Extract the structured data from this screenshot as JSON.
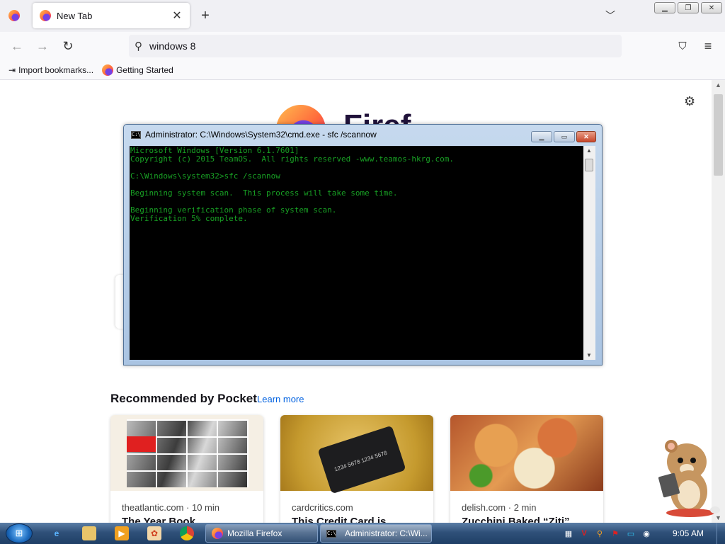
{
  "browser": {
    "tab": {
      "title": "New Tab"
    },
    "urlbar": {
      "value": "windows 8"
    },
    "bookmarks": [
      {
        "label": "Import bookmarks..."
      },
      {
        "label": "Getting Started"
      }
    ]
  },
  "newtab": {
    "brand_partial": "Firef",
    "pocket": {
      "title": "Recommended by Pocket",
      "learn_more": "Learn more",
      "cards": [
        {
          "source": "theatlantic.com · 10 min",
          "headline": "The Year Book"
        },
        {
          "source": "cardcritics.com",
          "headline": "This Credit Card is"
        },
        {
          "source": "delish.com · 2 min",
          "headline": "Zucchini Baked “Ziti”"
        }
      ]
    }
  },
  "cmd": {
    "title": "Administrator: C:\\Windows\\System32\\cmd.exe - sfc  /scannow",
    "lines": [
      "Microsoft Windows [Version 6.1.7601]",
      "Copyright (c) 2015 TeamOS.  All rights reserved -www.teamos-hkrg.com.",
      "",
      "C:\\Windows\\system32>sfc /scannow",
      "",
      "Beginning system scan.  This process will take some time.",
      "",
      "Beginning verification phase of system scan.",
      "Verification 5% complete."
    ],
    "text_color": "#18a024"
  },
  "taskbar": {
    "tasks": [
      {
        "label": "Mozilla Firefox"
      },
      {
        "label": "Administrator: C:\\Wi..."
      }
    ],
    "clock": "9:05 AM"
  }
}
